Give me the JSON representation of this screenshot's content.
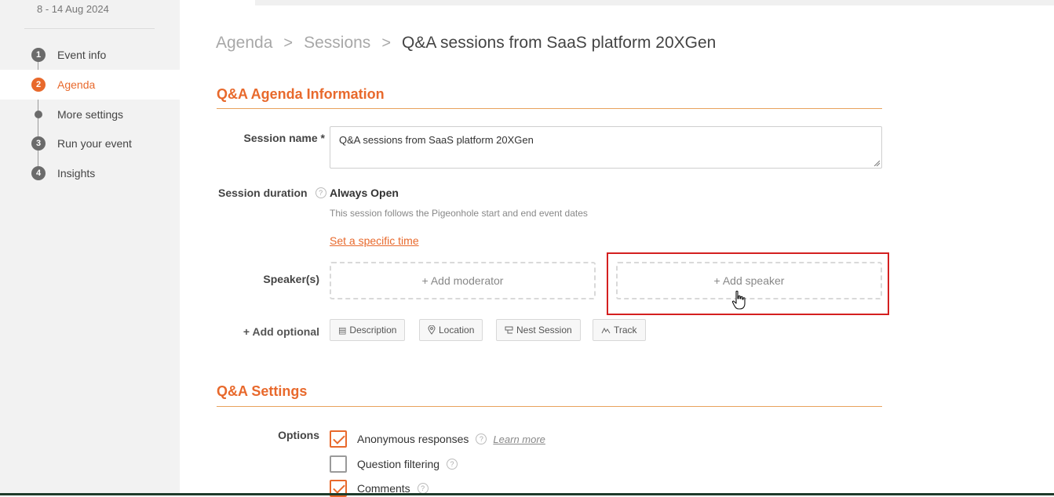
{
  "sidebar": {
    "date_range": "8 - 14 Aug 2024",
    "steps": [
      {
        "badge": "1",
        "label": "Event info",
        "active": false
      },
      {
        "badge": "2",
        "label": "Agenda",
        "active": true
      },
      {
        "badge": "",
        "label": "More settings",
        "active": false
      },
      {
        "badge": "3",
        "label": "Run your event",
        "active": false
      },
      {
        "badge": "4",
        "label": "Insights",
        "active": false
      }
    ]
  },
  "breadcrumb": {
    "items": [
      "Agenda",
      "Sessions"
    ],
    "separator": ">",
    "current": "Q&A sessions from SaaS platform 20XGen"
  },
  "agenda_section": {
    "title": "Q&A Agenda Information",
    "session_name_label": "Session name *",
    "session_name_value": "Q&A sessions from  SaaS platform 20XGen",
    "session_duration_label": "Session duration",
    "duration_value": "Always Open",
    "duration_note": "This session follows the Pigeonhole start and end event dates",
    "set_time_link": "Set a specific time",
    "speakers_label": "Speaker(s)",
    "add_moderator": "+ Add moderator",
    "add_speaker": "+ Add speaker",
    "add_optional_label": "+ Add optional",
    "optional_chips": [
      {
        "icon": "description-icon",
        "label": "Description"
      },
      {
        "icon": "location-pin-icon",
        "label": "Location"
      },
      {
        "icon": "nest-session-icon",
        "label": "Nest Session"
      },
      {
        "icon": "track-icon",
        "label": "Track"
      }
    ],
    "help_glyph": "?"
  },
  "settings_section": {
    "title": "Q&A Settings",
    "options_label": "Options",
    "options": [
      {
        "label": "Anonymous responses",
        "checked": true,
        "learn_more": "Learn more"
      },
      {
        "label": "Question filtering",
        "checked": false
      },
      {
        "label": "Comments",
        "checked": true
      }
    ]
  },
  "colors": {
    "accent": "#e8692c",
    "highlight_border": "#d42020",
    "sidebar_bg": "#f2f2f2"
  }
}
